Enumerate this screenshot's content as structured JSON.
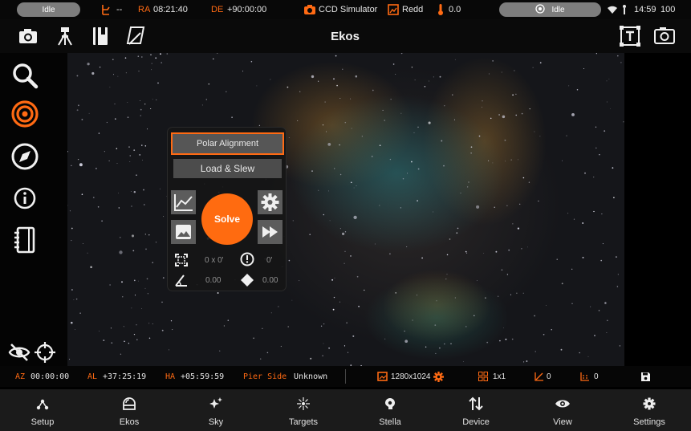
{
  "status_bar": {
    "left_status": "Idle",
    "mount_indicator": "--",
    "ra_label": "RA",
    "ra_value": "08:21:40",
    "de_label": "DE",
    "de_value": "+90:00:00",
    "camera_name": "CCD Simulator",
    "filter_name": "Redd",
    "temperature": "0.0",
    "right_status": "Idle",
    "clock": "14:59",
    "battery": "100"
  },
  "toolbar": {
    "title": "Ekos"
  },
  "align_panel": {
    "mode_button": "Polar Alignment",
    "load_button": "Load & Slew",
    "solve_button": "Solve",
    "fov_value": "0 x 0'",
    "error_value": "0'",
    "rotation_value": "0.00",
    "pixscale_value": "0.00"
  },
  "info_bar": {
    "az_label": "AZ",
    "az_value": "00:00:00",
    "al_label": "AL",
    "al_value": "+37:25:19",
    "ha_label": "HA",
    "ha_value": "+05:59:59",
    "pier_label": "Pier Side",
    "pier_value": "Unknown",
    "resolution": "1280x1024",
    "binning": "1x1",
    "gain_count": "0",
    "offset_count": "0"
  },
  "nav": {
    "items": [
      {
        "label": "Setup"
      },
      {
        "label": "Ekos"
      },
      {
        "label": "Sky"
      },
      {
        "label": "Targets"
      },
      {
        "label": "Stella"
      },
      {
        "label": "Device"
      },
      {
        "label": "View"
      },
      {
        "label": "Settings"
      }
    ]
  },
  "colors": {
    "accent": "#ff6a13",
    "success": "#29d12b",
    "panel": "#161616",
    "nav_bg": "#1b1b1b"
  },
  "icons": {
    "toolbar": [
      "camera-icon",
      "tripod-icon",
      "notebook-icon",
      "drawing-icon",
      "text-frame-icon",
      "screenshot-icon"
    ],
    "sidebar": [
      "search-icon",
      "target-icon",
      "compass-icon",
      "info-icon",
      "journal-icon"
    ],
    "overlay": [
      "visibility-off-icon",
      "crosshair-icon"
    ]
  }
}
